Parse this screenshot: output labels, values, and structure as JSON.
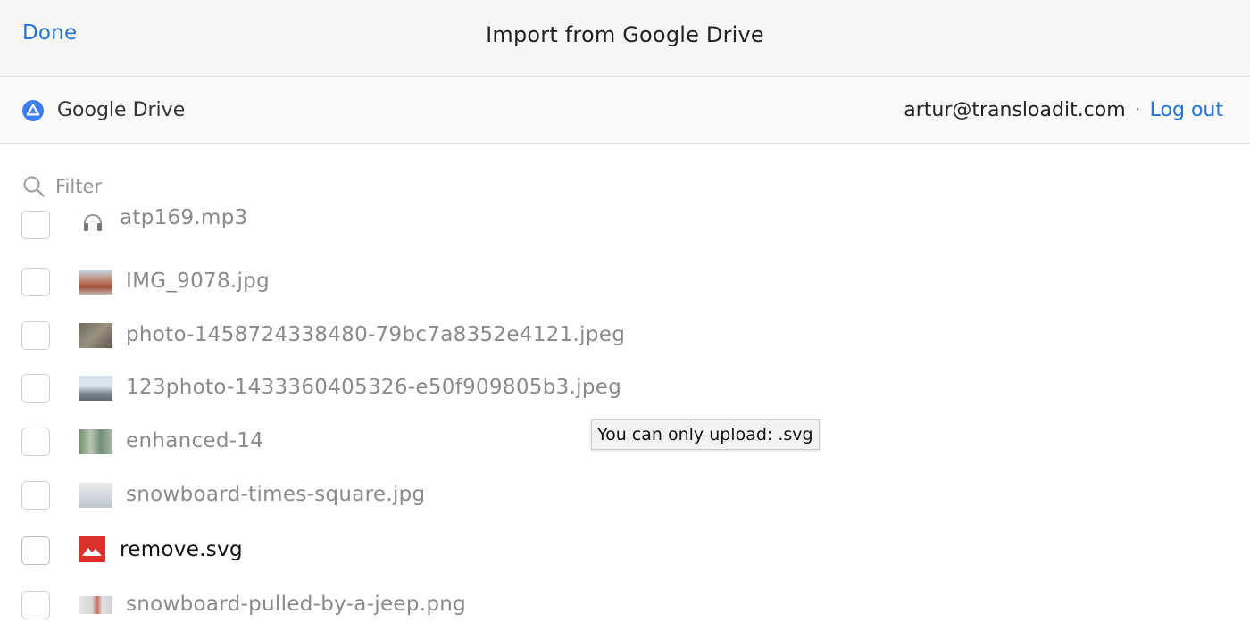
{
  "header": {
    "done_label": "Done",
    "title": "Import from Google Drive"
  },
  "provider": {
    "name": "Google Drive",
    "icon": "google-drive-icon",
    "account_email": "artur@transloadit.com",
    "separator": "·",
    "logout_label": "Log out"
  },
  "filter": {
    "placeholder": "Filter",
    "value": "",
    "icon": "search-icon"
  },
  "files": [
    {
      "name": "atp169.mp3",
      "icon": "headphones-icon",
      "disabled": true
    },
    {
      "name": "IMG_9078.jpg",
      "icon": "image-thumbnail",
      "disabled": true
    },
    {
      "name": "photo-1458724338480-79bc7a8352e4121.jpeg",
      "icon": "image-thumbnail",
      "disabled": true
    },
    {
      "name": "123photo-1433360405326-e50f909805b3.jpeg",
      "icon": "image-thumbnail",
      "disabled": true
    },
    {
      "name": "enhanced-14",
      "icon": "image-thumbnail",
      "disabled": true
    },
    {
      "name": "snowboard-times-square.jpg",
      "icon": "image-thumbnail",
      "disabled": true
    },
    {
      "name": "remove.svg",
      "icon": "svg-image-icon",
      "disabled": false
    },
    {
      "name": "snowboard-pulled-by-a-jeep.png",
      "icon": "image-thumbnail",
      "disabled": true
    }
  ],
  "tooltip": {
    "text": "You can only upload: .svg"
  },
  "colors": {
    "accent": "#2275d7",
    "svg_icon": "#d9312b"
  }
}
